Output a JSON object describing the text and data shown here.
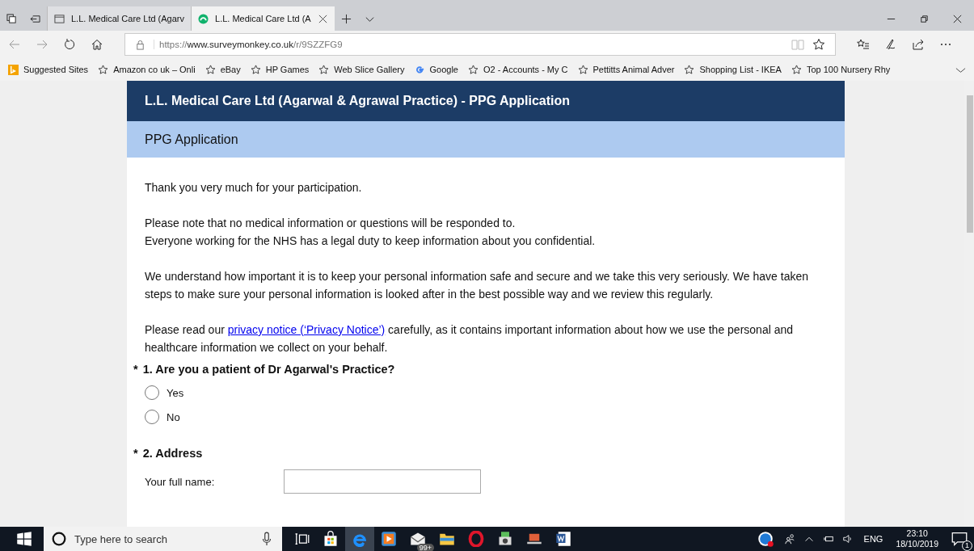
{
  "browser": {
    "tabs": [
      {
        "title": "L.L. Medical Care Ltd (Agarv",
        "selected": false,
        "kind": "page"
      },
      {
        "title": "L.L. Medical Care Ltd (A",
        "selected": true,
        "kind": "survey"
      }
    ],
    "url": {
      "scheme": "https://",
      "host": "www.surveymonkey.co.uk",
      "path": "/r/9SZZFG9"
    },
    "favorites": [
      {
        "label": "Suggested Sites",
        "kind": "bing"
      },
      {
        "label": "Amazon co uk – Onli",
        "kind": "star"
      },
      {
        "label": "eBay",
        "kind": "star"
      },
      {
        "label": "HP Games",
        "kind": "star"
      },
      {
        "label": "Web Slice Gallery",
        "kind": "star"
      },
      {
        "label": "Google",
        "kind": "google"
      },
      {
        "label": "O2 - Accounts - My C",
        "kind": "star"
      },
      {
        "label": "Pettitts Animal Adver",
        "kind": "star"
      },
      {
        "label": "Shopping List - IKEA",
        "kind": "star"
      },
      {
        "label": "Top 100 Nursery Rhy",
        "kind": "star"
      }
    ]
  },
  "survey": {
    "title": "L.L. Medical Care Ltd (Agarwal & Agrawal Practice) - PPG Application",
    "page_title": "PPG Application",
    "intro": [
      [
        "Thank you very much for your participation."
      ],
      [
        "Please note that no medical information or questions will be responded to.",
        "Everyone working for the NHS has a legal duty to keep information about you confidential."
      ],
      [
        "We understand how important it is to keep your personal information safe and secure and we take this very seriously. We have taken steps to make sure your personal information is looked after in the best possible way and we review this regularly."
      ]
    ],
    "privacy": {
      "before": "Please read our ",
      "link": "privacy notice (‘Privacy Notice’)",
      "after": " carefully, as it contains important information about how we use the personal and healthcare information we collect on your behalf."
    },
    "questions": [
      {
        "required_mark": "*",
        "title": "1. Are you a patient of Dr Agarwal's Practice?",
        "kind": "radio",
        "options": [
          {
            "label": "Yes",
            "selected": false
          },
          {
            "label": "No",
            "selected": false
          }
        ]
      },
      {
        "required_mark": "*",
        "title": "2. Address",
        "kind": "fields",
        "fields": [
          {
            "label": "Your full name:"
          }
        ]
      }
    ]
  },
  "taskbar": {
    "search_placeholder": "Type here to search",
    "mail_badge": "99+",
    "language": "ENG",
    "time": "23:10",
    "date": "18/10/2019",
    "notification_count": "1"
  }
}
